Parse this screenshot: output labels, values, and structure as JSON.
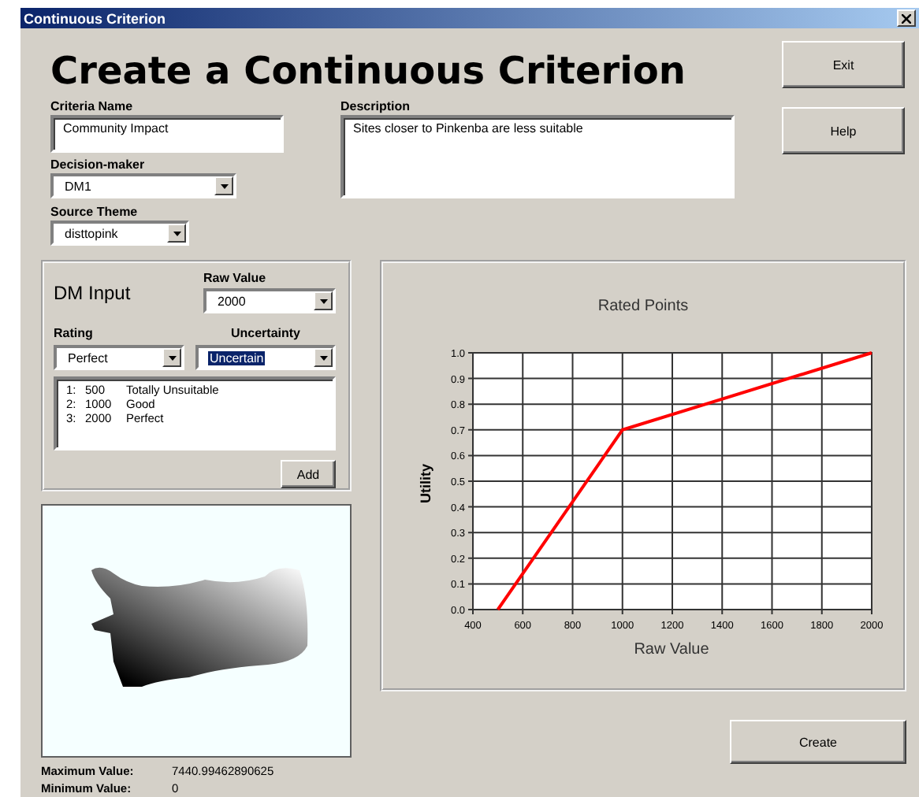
{
  "window": {
    "title": "Continuous Criterion"
  },
  "heading": "Create a Continuous Criterion",
  "criteria_name": {
    "label": "Criteria Name",
    "value": "Community Impact"
  },
  "decision_maker": {
    "label": "Decision-maker",
    "value": "DM1"
  },
  "source_theme": {
    "label": "Source Theme",
    "value": "disttopink"
  },
  "description": {
    "label": "Description",
    "value": "Sites closer to Pinkenba are less suitable"
  },
  "buttons": [
    "Exit",
    "Help"
  ],
  "dm_input": {
    "title": "DM Input",
    "raw_value": {
      "label": "Raw Value",
      "value": "2000"
    },
    "rating": {
      "label": "Rating",
      "value": "Perfect"
    },
    "uncertainty": {
      "label": "Uncertainty",
      "value": "Uncertain",
      "highlighted": true
    },
    "points": [
      {
        "index": "1:",
        "value": "500",
        "rating": "Totally Unsuitable"
      },
      {
        "index": "2:",
        "value": "1000",
        "rating": "Good"
      },
      {
        "index": "3:",
        "value": "2000",
        "rating": "Perfect"
      }
    ],
    "add_button": "Add"
  },
  "map": {
    "max_label": "Maximum Value:",
    "max_value": "7440.99462890625",
    "min_label": "Minimum Value:",
    "min_value": "0"
  },
  "chart": {
    "chart_data": {
      "type": "line",
      "title": "Rated Points",
      "xlabel": "Raw Value",
      "ylabel": "Utility",
      "x": [
        500,
        1000,
        2000
      ],
      "series": [
        {
          "color": "#ff0000",
          "values": [
            0,
            0.7,
            1
          ]
        }
      ],
      "grid": true,
      "xlim": [
        400,
        2000
      ],
      "ylim": [
        0,
        1
      ],
      "xticks": [
        400,
        600,
        800,
        1000,
        1200,
        1400,
        1600,
        1800,
        2000
      ],
      "yticks": [
        {
          "value": 0,
          "label": "0.0"
        },
        0.1,
        0.2,
        0.3,
        0.4,
        0.5,
        0.6,
        0.7,
        0.8,
        0.9,
        {
          "value": 1,
          "label": "1.0"
        }
      ]
    }
  },
  "create_button": "Create"
}
